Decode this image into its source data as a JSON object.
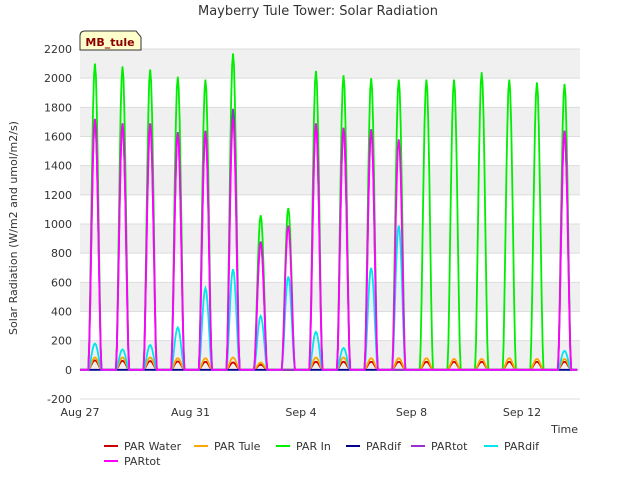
{
  "chart_data": {
    "type": "line",
    "title": "Mayberry Tule Tower: Solar Radiation",
    "badge": "MB_tule",
    "xlabel": "Time",
    "ylabel": "Solar Radiation (W/m2 and umol/m2/s)",
    "x_range": [
      "Aug 27",
      "Sep 14 00:00"
    ],
    "x_ticks": [
      {
        "label": "Aug 27",
        "day": 0
      },
      {
        "label": "Aug 31",
        "day": 4
      },
      {
        "label": "Sep 4",
        "day": 8
      },
      {
        "label": "Sep 8",
        "day": 12
      },
      {
        "label": "Sep 12",
        "day": 16
      }
    ],
    "ylim": [
      -200,
      2200
    ],
    "y_ticks": [
      -200,
      0,
      200,
      400,
      600,
      800,
      1000,
      1200,
      1400,
      1600,
      1800,
      2000,
      2200
    ],
    "grid": true,
    "legend_position": "bottom",
    "series": [
      {
        "name": "PAR Water",
        "color": "#cc0000",
        "x": [
          "Aug 27",
          "Aug 28",
          "Aug 29",
          "Aug 30",
          "Aug 31",
          "Sep 1",
          "Sep 2",
          "Sep 3",
          "Sep 4",
          "Sep 5",
          "Sep 6",
          "Sep 7",
          "Sep 8",
          "Sep 9",
          "Sep 10",
          "Sep 11",
          "Sep 12",
          "Sep 13"
        ],
        "daily_peak": [
          65,
          62,
          60,
          58,
          55,
          50,
          35,
          0,
          55,
          55,
          55,
          55,
          55,
          55,
          55,
          55,
          55,
          55
        ]
      },
      {
        "name": "PAR Tule",
        "color": "#ffa500",
        "x": [
          "Aug 27",
          "Aug 28",
          "Aug 29",
          "Aug 30",
          "Aug 31",
          "Sep 1",
          "Sep 2",
          "Sep 3",
          "Sep 4",
          "Sep 5",
          "Sep 6",
          "Sep 7",
          "Sep 8",
          "Sep 9",
          "Sep 10",
          "Sep 11",
          "Sep 12",
          "Sep 13"
        ],
        "daily_peak": [
          85,
          85,
          85,
          80,
          80,
          85,
          50,
          0,
          85,
          85,
          80,
          80,
          80,
          75,
          75,
          80,
          75,
          75
        ]
      },
      {
        "name": "PAR In",
        "color": "#00ee00",
        "x": [
          "Aug 27",
          "Aug 28",
          "Aug 29",
          "Aug 30",
          "Aug 31",
          "Sep 1",
          "Sep 2",
          "Sep 3",
          "Sep 4",
          "Sep 5",
          "Sep 6",
          "Sep 7",
          "Sep 8",
          "Sep 9",
          "Sep 10",
          "Sep 11",
          "Sep 12",
          "Sep 13"
        ],
        "daily_peak": [
          2100,
          2080,
          2060,
          2010,
          1990,
          2170,
          1060,
          1110,
          2050,
          2020,
          2000,
          1990,
          1990,
          1990,
          2040,
          1990,
          1970,
          1960
        ]
      },
      {
        "name": "PARdif",
        "color": "#00008b",
        "x": [
          "Aug 27",
          "Sep 13"
        ],
        "daily_peak": [
          0,
          0
        ]
      },
      {
        "name": "PARtot",
        "color": "#9932cc",
        "x": [
          "Aug 27",
          "Aug 28",
          "Aug 29",
          "Aug 30",
          "Aug 31",
          "Sep 1",
          "Sep 2",
          "Sep 3",
          "Sep 4",
          "Sep 5",
          "Sep 6",
          "Sep 7",
          "Sep 8",
          "Sep 9",
          "Sep 10",
          "Sep 11",
          "Sep 12",
          "Sep 13"
        ],
        "daily_peak": [
          1720,
          1690,
          1690,
          1630,
          1640,
          1790,
          880,
          0,
          1690,
          1660,
          1650,
          0,
          0,
          0,
          0,
          0,
          0,
          1640
        ]
      },
      {
        "name": "PARdif",
        "color": "#00e5ee",
        "x": [
          "Aug 27",
          "Aug 28",
          "Aug 29",
          "Aug 30",
          "Aug 31",
          "Sep 1",
          "Sep 2",
          "Sep 3",
          "Sep 4",
          "Sep 5",
          "Sep 6",
          "Sep 7",
          "Sep 8",
          "Sep 9",
          "Sep 10",
          "Sep 11",
          "Sep 12",
          "Sep 13"
        ],
        "daily_peak": [
          180,
          140,
          170,
          290,
          560,
          690,
          370,
          640,
          260,
          150,
          700,
          990,
          0,
          0,
          0,
          0,
          0,
          130
        ]
      },
      {
        "name": "PARtot",
        "color": "#ff00ff",
        "x": [
          "Aug 27",
          "Aug 28",
          "Aug 29",
          "Aug 30",
          "Aug 31",
          "Sep 1",
          "Sep 2",
          "Sep 3",
          "Sep 4",
          "Sep 5",
          "Sep 6",
          "Sep 7",
          "Sep 8",
          "Sep 9",
          "Sep 10",
          "Sep 11",
          "Sep 12",
          "Sep 13"
        ],
        "daily_peak": [
          1720,
          1690,
          1690,
          1620,
          1630,
          1720,
          870,
          990,
          1690,
          1660,
          1640,
          1580,
          0,
          0,
          0,
          0,
          0,
          1640
        ]
      }
    ]
  }
}
